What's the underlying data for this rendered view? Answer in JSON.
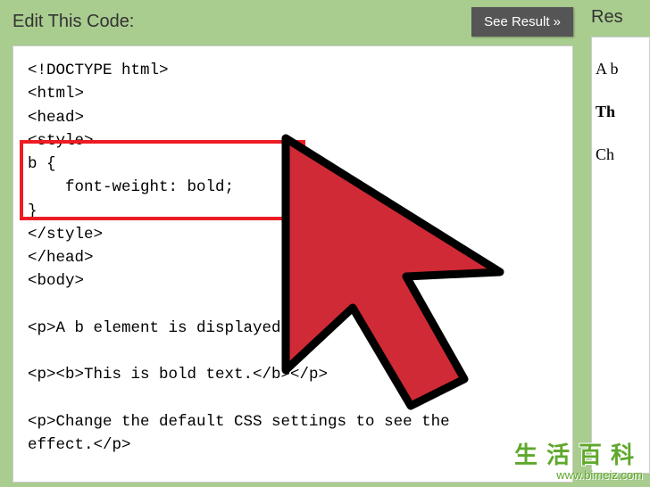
{
  "left": {
    "heading": "Edit This Code:",
    "button_label": "See Result »",
    "code": "<!DOCTYPE html>\n<html>\n<head>\n<style>\nb {\n    font-weight: bold;\n}\n</style>\n</head>\n<body>\n\n<p>A b element is displayed like      /p>\n\n<p><b>This is bold text.</b></p>\n\n<p>Change the default CSS settings to see the\neffect.</p>"
  },
  "right": {
    "heading": "Res",
    "line1": "A b",
    "line2": "Th",
    "line3": "Ch"
  },
  "watermark": {
    "cn": "生活百科",
    "url": "www.bimeiz.com"
  }
}
